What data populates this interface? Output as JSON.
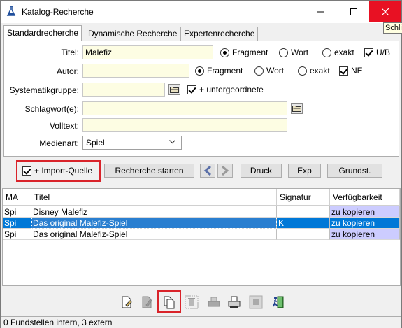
{
  "window": {
    "title": "Katalog-Recherche",
    "close_tooltip": "Schließen"
  },
  "tabs": [
    {
      "label": "Standardrecherche",
      "active": true
    },
    {
      "label": "Dynamische Recherche",
      "active": false
    },
    {
      "label": "Expertenrecherche",
      "active": false
    }
  ],
  "form": {
    "titel": {
      "label": "Titel:",
      "value": "Malefiz"
    },
    "titel_mode": {
      "fragment": "Fragment",
      "wort": "Wort",
      "exakt": "exakt",
      "selected": "fragment"
    },
    "titel_ub": {
      "label": "U/B",
      "checked": true
    },
    "autor": {
      "label": "Autor:",
      "value": ""
    },
    "autor_mode": {
      "fragment": "Fragment",
      "wort": "Wort",
      "exakt": "exakt",
      "selected": "fragment"
    },
    "autor_ne": {
      "label": "NE",
      "checked": true
    },
    "systematik": {
      "label": "Systematikgruppe:",
      "value": ""
    },
    "untergeordnete": {
      "label": "+ untergeordnete",
      "checked": true
    },
    "schlagwort": {
      "label": "Schlagwort(e):",
      "value": ""
    },
    "volltext": {
      "label": "Volltext:",
      "value": ""
    },
    "medienart": {
      "label": "Medienart:",
      "value": "Spiel"
    }
  },
  "actions": {
    "import_quelle": {
      "label": "+ Import-Quelle",
      "checked": true
    },
    "recherche": "Recherche starten",
    "druck": "Druck",
    "exp": "Exp",
    "grundst": "Grundst."
  },
  "table": {
    "columns": [
      "MA",
      "Titel",
      "Signatur",
      "Verfügbarkeit"
    ],
    "rows": [
      {
        "ma": "Spi",
        "titel": "Disney Malefiz",
        "signatur": "",
        "verf": "zu kopieren",
        "selected": false
      },
      {
        "ma": "Spi",
        "titel": "Das original Malefiz-Spiel",
        "signatur": "K",
        "verf": "zu kopieren",
        "selected": true
      },
      {
        "ma": "Spi",
        "titel": "Das original Malefiz-Spiel",
        "signatur": "",
        "verf": "zu kopieren",
        "selected": false
      }
    ]
  },
  "status": "0 Fundstellen intern, 3 extern",
  "colors": {
    "accent_red": "#d9232a",
    "selection": "#0078d7",
    "input_bg": "#fdfde3",
    "availability_bg": "#ccccff"
  }
}
